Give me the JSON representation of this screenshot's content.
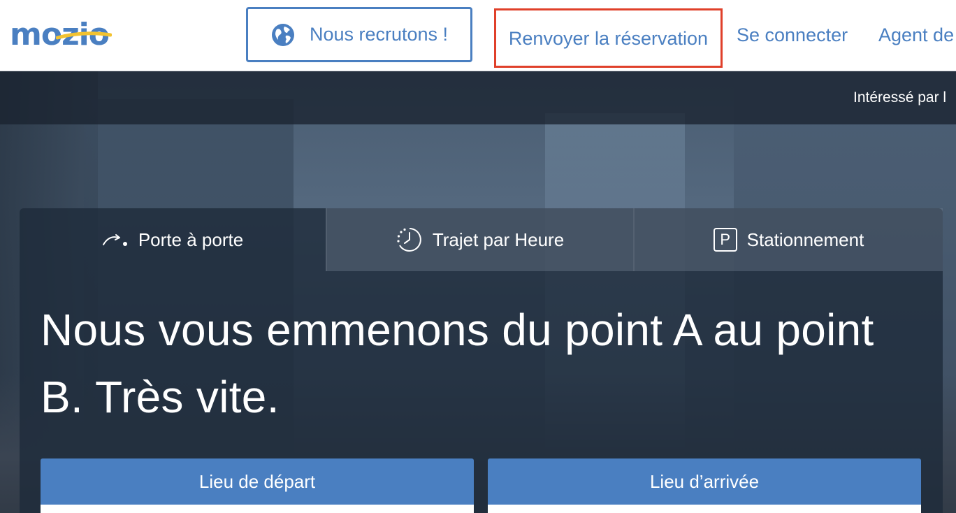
{
  "header": {
    "logo_text": "mozio",
    "recruit_label": "Nous recrutons !",
    "nav": {
      "resend": "Renvoyer la réservation",
      "login": "Se connecter",
      "agent": "Agent de"
    }
  },
  "promo": {
    "text": "Intéressé par l"
  },
  "tabs": [
    {
      "label": "Porte à porte",
      "icon": "door-to-door-icon"
    },
    {
      "label": "Trajet par Heure",
      "icon": "hourly-clock-icon"
    },
    {
      "label": "Stationnement",
      "icon": "parking-icon",
      "icon_glyph": "P"
    }
  ],
  "hero": {
    "headline": "Nous vous emmenons du point A au point B. Très vite."
  },
  "form": {
    "departure_label": "Lieu de départ",
    "arrival_label": "Lieu d’arrivée"
  },
  "colors": {
    "brand_blue": "#4a7fc1",
    "highlight_red": "#e0402a",
    "logo_swoosh": "#f2c230"
  }
}
